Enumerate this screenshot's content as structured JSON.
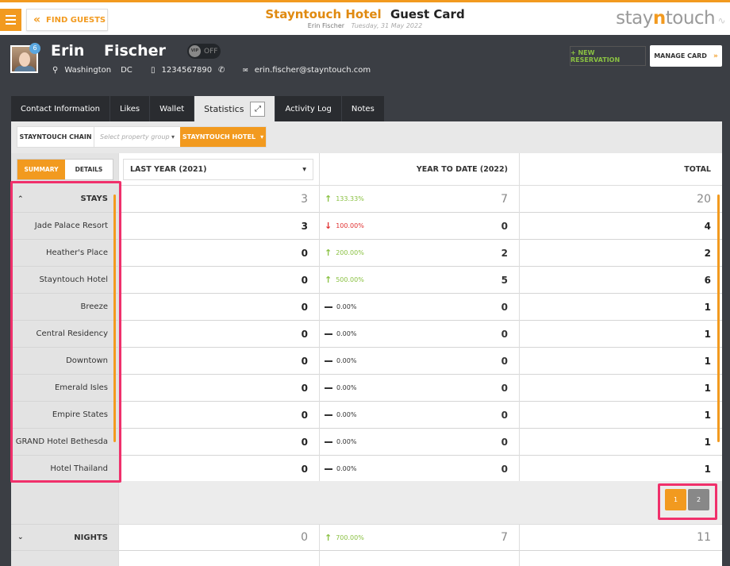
{
  "header": {
    "find_guests": "FIND GUESTS",
    "hotel_name": "Stayntouch Hotel",
    "card_title": "Guest Card",
    "user_name": "Erin Fischer",
    "date": "Tuesday, 31 May 2022",
    "logo_part1": "stay",
    "logo_part2": "n",
    "logo_part3": "touch"
  },
  "profile": {
    "badge_count": "6",
    "first_name": "Erin",
    "last_name": "Fischer",
    "vip_label": "VIP",
    "vip_state": "OFF",
    "city": "Washington",
    "state": "DC",
    "phone": "1234567890",
    "email": "erin.fischer@stayntouch.com",
    "new_reservation": "+ NEW RESERVATION",
    "manage_card": "MANAGE CARD"
  },
  "tabs": [
    {
      "label": "Contact Information"
    },
    {
      "label": "Likes"
    },
    {
      "label": "Wallet"
    },
    {
      "label": "Statistics"
    },
    {
      "label": "Activity Log"
    },
    {
      "label": "Notes"
    }
  ],
  "filters": {
    "chain": "STAYNTOUCH CHAIN",
    "property_group_placeholder": "Select property group",
    "hotel": "STAYNTOUCH HOTEL"
  },
  "view_toggle": {
    "summary": "SUMMARY",
    "details": "DETAILS"
  },
  "columns": {
    "last_year": "LAST YEAR (2021)",
    "ytd": "YEAR TO DATE (2022)",
    "total": "TOTAL"
  },
  "stays": {
    "label": "STAYS",
    "last_year": "3",
    "change": "133.33%",
    "ytd": "7",
    "total": "20"
  },
  "rows": [
    {
      "name": "Jade Palace Resort",
      "last_year": "3",
      "change": "100.00%",
      "dir": "down",
      "ytd": "0",
      "total": "4"
    },
    {
      "name": "Heather's Place",
      "last_year": "0",
      "change": "200.00%",
      "dir": "up",
      "ytd": "2",
      "total": "2"
    },
    {
      "name": "Stayntouch Hotel",
      "last_year": "0",
      "change": "500.00%",
      "dir": "up",
      "ytd": "5",
      "total": "6"
    },
    {
      "name": "Breeze",
      "last_year": "0",
      "change": "0.00%",
      "dir": "flat",
      "ytd": "0",
      "total": "1"
    },
    {
      "name": "Central Residency",
      "last_year": "0",
      "change": "0.00%",
      "dir": "flat",
      "ytd": "0",
      "total": "1"
    },
    {
      "name": "Downtown",
      "last_year": "0",
      "change": "0.00%",
      "dir": "flat",
      "ytd": "0",
      "total": "1"
    },
    {
      "name": "Emerald Isles",
      "last_year": "0",
      "change": "0.00%",
      "dir": "flat",
      "ytd": "0",
      "total": "1"
    },
    {
      "name": "Empire States",
      "last_year": "0",
      "change": "0.00%",
      "dir": "flat",
      "ytd": "0",
      "total": "1"
    },
    {
      "name": "GRAND Hotel Bethesda",
      "last_year": "0",
      "change": "0.00%",
      "dir": "flat",
      "ytd": "0",
      "total": "1"
    },
    {
      "name": "Hotel Thailand",
      "last_year": "0",
      "change": "0.00%",
      "dir": "flat",
      "ytd": "0",
      "total": "1"
    }
  ],
  "pagination": {
    "page1": "1",
    "page2": "2"
  },
  "nights": {
    "label": "NIGHTS",
    "last_year": "0",
    "change": "700.00%",
    "ytd": "7",
    "total": "11"
  },
  "colors": {
    "accent": "#f29a1f",
    "up": "#8ac142",
    "down": "#e03030",
    "highlight": "#f0306b"
  }
}
